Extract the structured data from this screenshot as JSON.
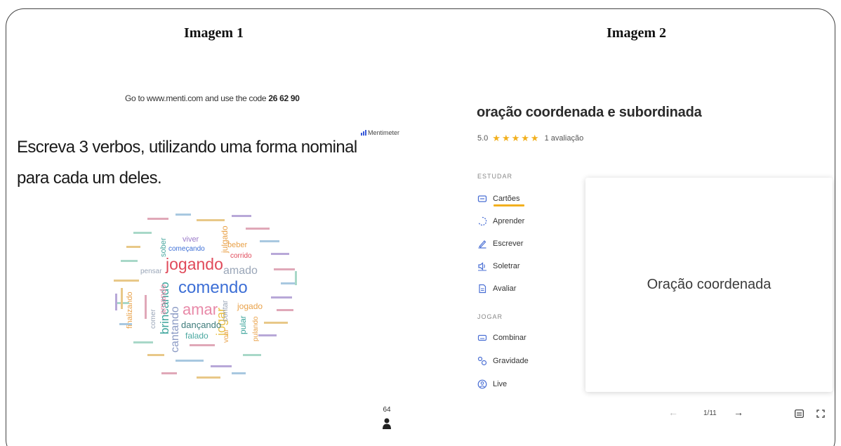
{
  "image1": {
    "title": "Imagem 1",
    "code_prefix": "Go to www.menti.com and use the code ",
    "code": "26 62 90",
    "logo": "Mentimeter",
    "question": "Escreva 3 verbos, utilizando uma forma nominal para cada um deles.",
    "participants": "64",
    "cloud_words": [
      {
        "t": "comendo",
        "c": "#3d6fd6"
      },
      {
        "t": "jogando",
        "c": "#e04a5a"
      },
      {
        "t": "amar",
        "c": "#e889a8"
      },
      {
        "t": "brincando",
        "c": "#3aa39a"
      },
      {
        "t": "amado",
        "c": "#9aa6b8"
      },
      {
        "t": "jogar",
        "c": "#e9c24a"
      },
      {
        "t": "cantando",
        "c": "#8b9ac4"
      },
      {
        "t": "dançando",
        "c": "#3e7b7a"
      },
      {
        "t": "falado",
        "c": "#4aa8a0"
      },
      {
        "t": "jogado",
        "c": "#e9a24a"
      },
      {
        "t": "beber",
        "c": "#e9a24a"
      },
      {
        "t": "viver",
        "c": "#9a7ac8"
      },
      {
        "t": "começando",
        "c": "#3d6fd6"
      },
      {
        "t": "pensar",
        "c": "#9aa6b8"
      },
      {
        "t": "comer",
        "c": "#9aa6b8"
      },
      {
        "t": "amando",
        "c": "#e889a8"
      },
      {
        "t": "finalizando",
        "c": "#e9a24a"
      },
      {
        "t": "sober",
        "c": "#4aa8a0"
      },
      {
        "t": "julgado",
        "c": "#e9a24a"
      },
      {
        "t": "corrido",
        "c": "#e04a5a"
      },
      {
        "t": "contar",
        "c": "#9aa6b8"
      },
      {
        "t": "voar",
        "c": "#e9a24a"
      },
      {
        "t": "pular",
        "c": "#3aa39a"
      },
      {
        "t": "pulando",
        "c": "#e9a24a"
      }
    ]
  },
  "image2": {
    "title": "Imagem 2",
    "set_title": "oração coordenada e subordinada",
    "rating_value": "5.0",
    "stars": "★★★★★",
    "rating_count": "1 avaliação",
    "study_label": "ESTUDAR",
    "study_modes": [
      "Cartões",
      "Aprender",
      "Escrever",
      "Soletrar",
      "Avaliar"
    ],
    "play_label": "JOGAR",
    "play_modes": [
      "Combinar",
      "Gravidade",
      "Live"
    ],
    "card_text": "Oração coordenada",
    "counter": "1/11",
    "prev": "←",
    "next": "→"
  }
}
